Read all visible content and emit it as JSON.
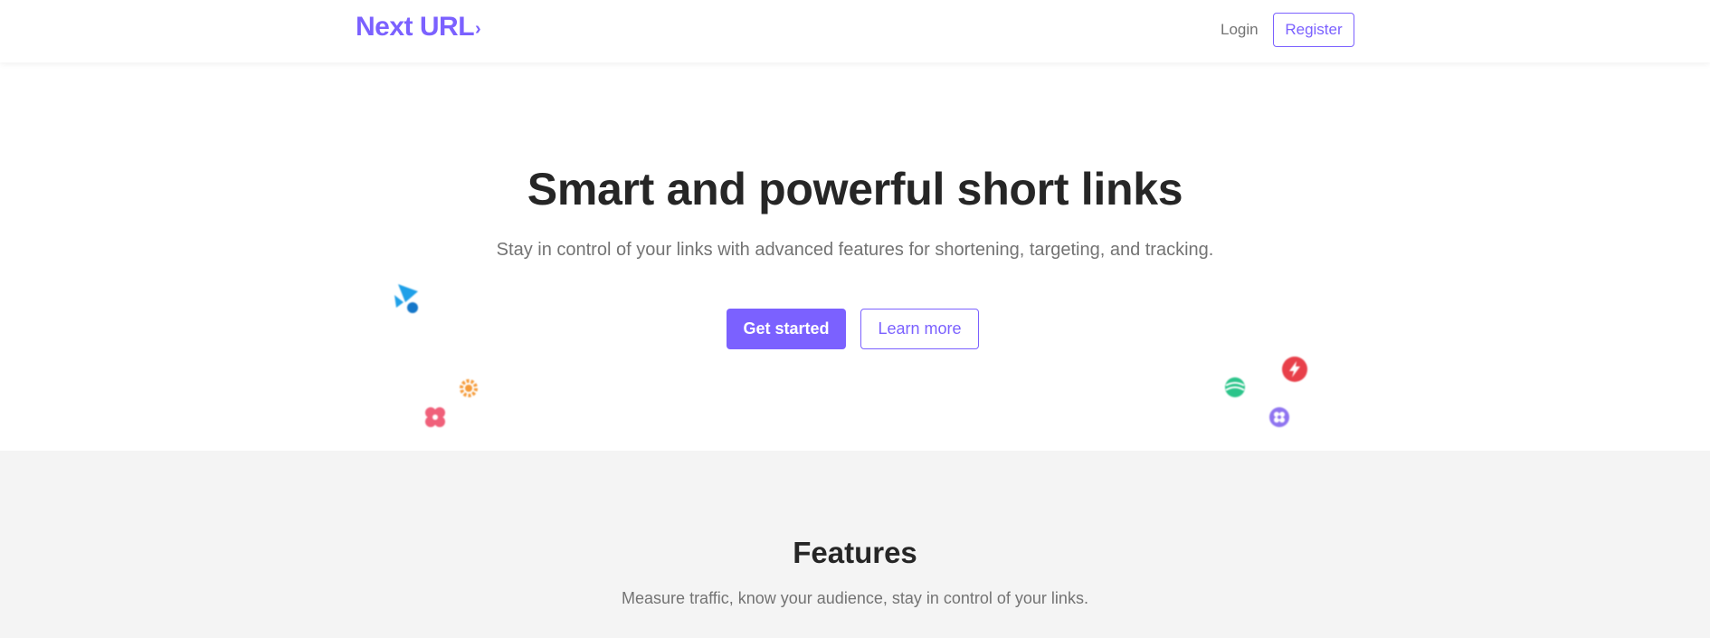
{
  "header": {
    "logo_text": "Next URL",
    "logo_arrow": "›",
    "login_label": "Login",
    "register_label": "Register"
  },
  "hero": {
    "title": "Smart and powerful short links",
    "subtitle": "Stay in control of your links with advanced features for shortening, targeting, and tracking.",
    "primary_button": "Get started",
    "secondary_button": "Learn more",
    "decorative_icons": [
      "blue-triangle-icon",
      "orange-gear-icon",
      "pink-flower-icon",
      "green-ball-icon",
      "red-bolt-icon",
      "purple-flower-icon"
    ]
  },
  "features": {
    "title": "Features",
    "subtitle": "Measure traffic, know your audience, stay in control of your links."
  },
  "colors": {
    "accent": "#7b61ff",
    "text_dark": "#262626",
    "text_muted": "#737373",
    "section_bg": "#f4f4f4"
  }
}
